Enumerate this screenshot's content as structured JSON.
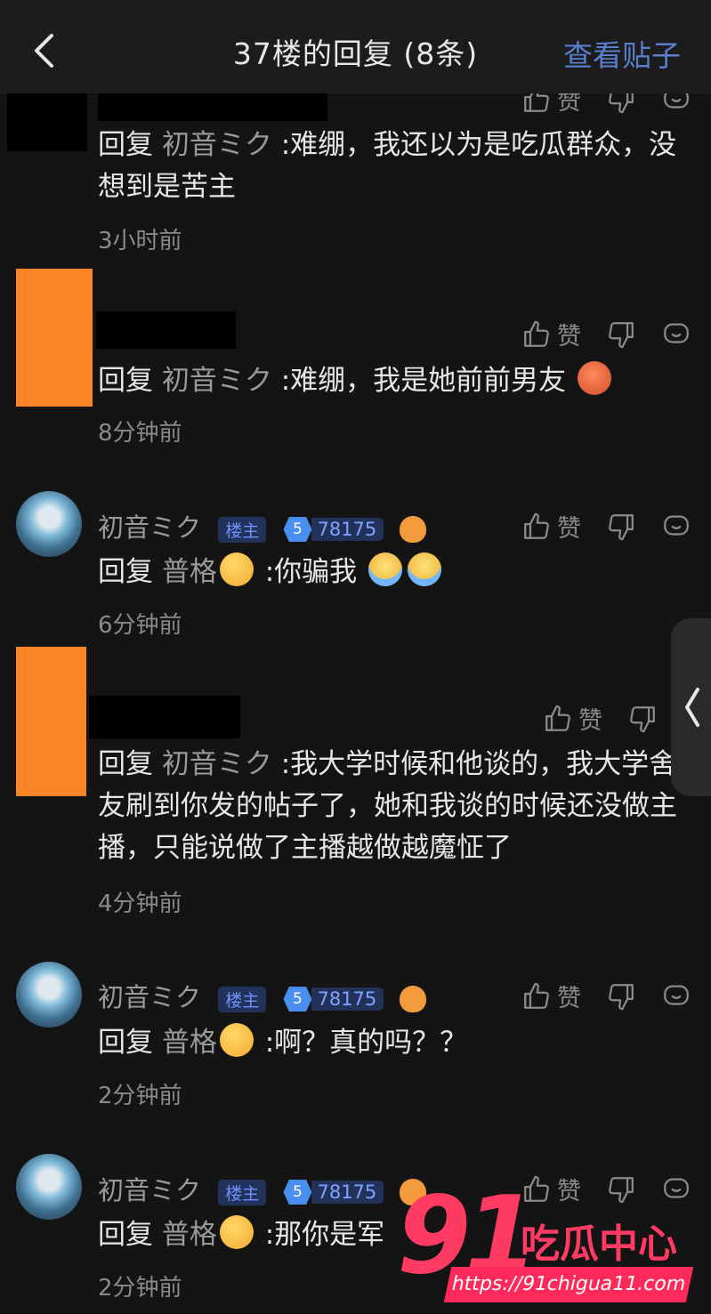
{
  "header": {
    "title": "37楼的回复 (8条)",
    "view_post": "查看贴子"
  },
  "actions": {
    "like": "赞"
  },
  "replies": [
    {
      "reply_prefix": "回复",
      "mention": "初音ミク",
      "content": ":难绷，我还以为是吃瓜群众，没想到是苦主",
      "time": "3小时前"
    },
    {
      "reply_prefix": "回复",
      "mention": "初音ミク",
      "content": ":难绷，我是她前前男友",
      "time": "8分钟前"
    },
    {
      "author": "初音ミク",
      "host_badge": "楼主",
      "level": "5",
      "score": "78175",
      "reply_prefix": "回复",
      "mention": "普格",
      "content": ":你骗我",
      "time": "6分钟前"
    },
    {
      "reply_prefix": "回复",
      "mention": "初音ミク",
      "content": ":我大学时候和他谈的，我大学舍友刷到你发的帖子了，她和我谈的时候还没做主播，只能说做了主播越做越魔怔了",
      "time": "4分钟前"
    },
    {
      "author": "初音ミク",
      "host_badge": "楼主",
      "level": "5",
      "score": "78175",
      "reply_prefix": "回复",
      "mention": "普格",
      "content": ":啊？真的吗？？",
      "time": "2分钟前"
    },
    {
      "author": "初音ミク",
      "host_badge": "楼主",
      "level": "5",
      "score": "78175",
      "reply_prefix": "回复",
      "mention": "普格",
      "content": ":那你是军",
      "time": "2分钟前"
    }
  ],
  "watermark": {
    "number": "91",
    "name": "吃瓜中心",
    "url": "https://91chigua11.com",
    "color": "#ff3b64"
  }
}
